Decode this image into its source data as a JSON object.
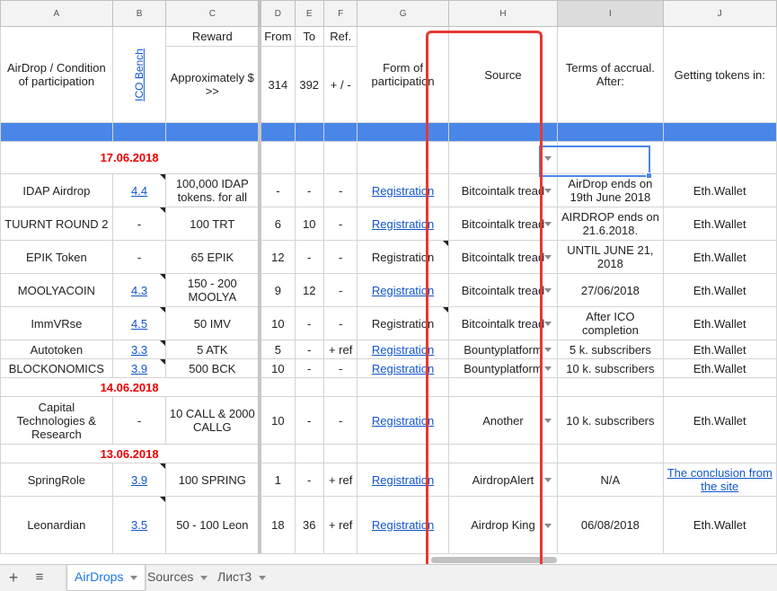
{
  "columns": [
    "A",
    "B",
    "C",
    "D",
    "E",
    "F",
    "G",
    "H",
    "I",
    "J"
  ],
  "header": {
    "a": "AirDrop / Condition of participation",
    "b": "ICO Bench",
    "c_top": "Reward",
    "c_bottom": "Approximately $ >>",
    "d_top": "From",
    "d_bottom": "314",
    "e_top": "To",
    "e_bottom": "392",
    "f_top": "Ref.",
    "f_bottom": "+ / -",
    "g": "Form of participation",
    "h": "Source",
    "i": "Terms of accrual. After:",
    "j": "Getting tokens in:"
  },
  "dates": [
    "17.06.2018",
    "14.06.2018",
    "13.06.2018"
  ],
  "rows": [
    {
      "a": "IDAP Airdrop",
      "b": "4.4",
      "c": "100,000 IDAP tokens. for all",
      "d": "-",
      "e": "-",
      "f": "-",
      "g": "Registration",
      "h": "Bitcointalk tread",
      "i": "AirDrop ends on 19th June 2018",
      "j": "Eth.Wallet"
    },
    {
      "a": "TUURNT ROUND 2",
      "b": "-",
      "c": "100 TRT",
      "d": "6",
      "e": "10",
      "f": "-",
      "g": "Registration",
      "h": "Bitcointalk tread",
      "i": "AIRDROP ends on 21.6.2018.",
      "j": "Eth.Wallet"
    },
    {
      "a": "EPIK Token",
      "b": "-",
      "c": "65 EPIK",
      "d": "12",
      "e": "-",
      "f": "-",
      "g": "Registration",
      "h": "Bitcointalk tread",
      "i": "UNTIL JUNE 21, 2018",
      "j": "Eth.Wallet"
    },
    {
      "a": "MOOLYACOIN",
      "b": "4.3",
      "c": "150 - 200 MOOLYA",
      "d": "9",
      "e": "12",
      "f": "-",
      "g": "Registration",
      "h": "Bitcointalk tread",
      "i": "27/06/2018",
      "j": "Eth.Wallet"
    },
    {
      "a": "ImmVRse",
      "b": "4.5",
      "c": "50 IMV",
      "d": "10",
      "e": "-",
      "f": "-",
      "g": "Registration",
      "h": "Bitcointalk tread",
      "i": "After ICO completion",
      "j": "Eth.Wallet"
    },
    {
      "a": "Autotoken",
      "b": "3.3",
      "c": "5 ATK",
      "d": "5",
      "e": "-",
      "f": "+ ref",
      "g": "Registration",
      "h": "Bountyplatform",
      "i": "5 k. subscribers",
      "j": "Eth.Wallet"
    },
    {
      "a": "BLOCKONOMICS",
      "b": "3.9",
      "c": "500 BCK",
      "d": "10",
      "e": "-",
      "f": "-",
      "g": "Registration",
      "h": "Bountyplatform",
      "i": "10 k. subscribers",
      "j": "Eth.Wallet"
    },
    {
      "a": "Capital Technologies & Research",
      "b": "-",
      "c": "10 CALL & 2000 CALLG",
      "d": "10",
      "e": "-",
      "f": "-",
      "g": "Registration",
      "h": "Another",
      "i": "10 k. subscribers",
      "j": "Eth.Wallet"
    },
    {
      "a": "SpringRole",
      "b": "3.9",
      "c": "100 SPRING",
      "d": "1",
      "e": "-",
      "f": "+ ref",
      "g": "Registration",
      "h": "AirdropAlert",
      "i": "N/A",
      "j": "The conclusion from the site"
    },
    {
      "a": "Leonardian",
      "b": "3.5",
      "c": "50 - 100 Leon",
      "d": "18",
      "e": "36",
      "f": "+ ref",
      "g": "Registration",
      "h": "Airdrop King",
      "i": "06/08/2018",
      "j": "Eth.Wallet"
    }
  ],
  "tabs": [
    "AirDrops",
    "Sources",
    "Лист3"
  ],
  "icons": {
    "add": "plus-icon",
    "list": "list-icon",
    "dropdown": "chevron-down-icon"
  },
  "colors": {
    "accent": "#4a86e8",
    "date": "#e00000",
    "highlight": "#e53935",
    "link": "#1155cc"
  }
}
